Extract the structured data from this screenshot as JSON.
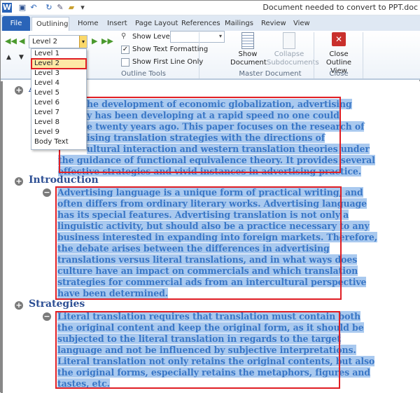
{
  "window": {
    "title": "Document needed to convert to PPT.doc"
  },
  "quick_access": [
    "word-icon",
    "save-icon",
    "undo-icon",
    "redo-icon",
    "attach-icon",
    "folder-icon",
    "customize-icon"
  ],
  "tabs": {
    "file": "File",
    "items": [
      "Outlining",
      "Home",
      "Insert",
      "Page Layout",
      "References",
      "Mailings",
      "Review",
      "View"
    ],
    "active": "Outlining"
  },
  "outline_tools": {
    "level_value": "Level 2",
    "show_level_label": "Show Level:",
    "show_level_value": "",
    "show_text_formatting": {
      "label": "Show Text Formatting",
      "checked": true
    },
    "show_first_line_only": {
      "label": "Show First Line Only",
      "checked": false
    },
    "group_label": "Outline Tools"
  },
  "master_document": {
    "show_document": [
      "Show",
      "Document"
    ],
    "collapse_subdocuments": [
      "Collapse",
      "Subdocuments"
    ],
    "group_label": "Master Document"
  },
  "close_group": {
    "close_outline_view": [
      "Close",
      "Outline View"
    ],
    "group_label": "Close"
  },
  "level_dropdown": {
    "items": [
      "Level 1",
      "Level 2",
      "Level 3",
      "Level 4",
      "Level 5",
      "Level 6",
      "Level 7",
      "Level 8",
      "Level 9",
      "Body Text"
    ],
    "selected": "Level 2"
  },
  "document": {
    "section1": {
      "heading": "A",
      "lines": [
        "he development of economic globalization, advertising",
        "y has been developing at a rapid speed no one could",
        "e twenty years ago. This paper focuses on the research of",
        "ising translation strategies with the directions of",
        "ultural interaction and western translation theories under",
        "the guidance of functional equivalence theory. It provides several",
        "effective strategies and vivid instances in advertising practice."
      ]
    },
    "section2": {
      "heading": "Introduction",
      "lines": [
        "Advertising language is a unique form of practical writing, and",
        "often differs from ordinary literary works. Advertising language",
        "has its special features. Advertising translation is not only a",
        "linguistic activity, but should also be a practice necessary to any",
        "business interested in expanding into foreign markets. Therefore,",
        "the debate arises between the differences in advertising",
        "translations versus literal translations, and in what ways does",
        "culture have an impact on commercials and which translation",
        "strategies for commercial ads from an intercultural perspective",
        "have been determined."
      ]
    },
    "section3": {
      "heading": "Strategies",
      "lines": [
        "Literal translation requires that translation must contain both",
        "the original content and keep the original form, as it should be",
        "subjected to the literal translation in regards to the target",
        "language and not be influenced by subjective interpretations.",
        "Literal translation not only retains the original contents, but also",
        "the original forms, especially retains the metaphors, figures and",
        "tastes, etc."
      ]
    }
  },
  "colors": {
    "highlight": "#a9c9ef",
    "annotation_box": "#e01e24",
    "file_tab": "#2a64b8"
  }
}
